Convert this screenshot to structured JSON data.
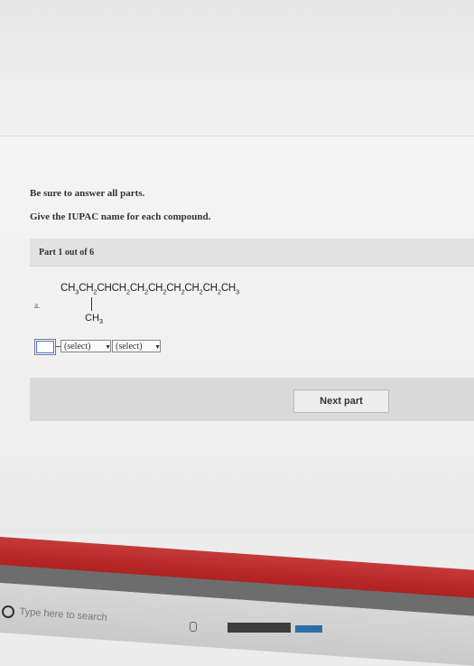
{
  "instructions": {
    "line1": "Be sure to answer all parts.",
    "line2": "Give the IUPAC name for each compound."
  },
  "part": {
    "label": "Part 1 out of 6"
  },
  "question": {
    "letter": "a.",
    "formula": {
      "segments": [
        "CH",
        "3",
        "CH",
        "2",
        "CHCH",
        "2",
        "CH",
        "2",
        "CH",
        "2",
        "CH",
        "2",
        "CH",
        "2",
        "CH",
        "2",
        "CH",
        "3"
      ]
    },
    "branch": {
      "base": "CH",
      "sub": "3"
    }
  },
  "answer": {
    "input_value": "",
    "select1": "(select)",
    "select2": "(select)"
  },
  "buttons": {
    "next_part": "Next part"
  },
  "taskbar": {
    "search_placeholder": "Type here to search"
  },
  "colors": {
    "red_band": "#b92727",
    "focus_outline": "#4a6fd0"
  }
}
